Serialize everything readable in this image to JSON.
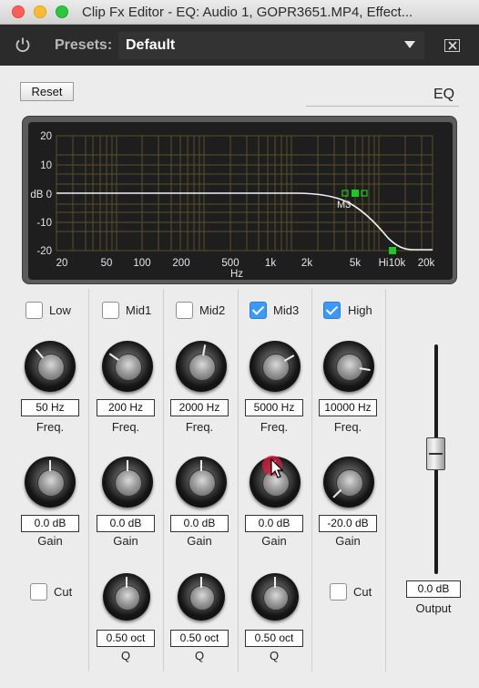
{
  "window": {
    "title": "Clip Fx Editor - EQ: Audio 1, GOPR3651.MP4, Effect..."
  },
  "toolbar": {
    "presets_label": "Presets:",
    "preset_value": "Default"
  },
  "reset_label": "Reset",
  "eq_label": "EQ",
  "graph": {
    "y_ticks": [
      "20",
      "10",
      "dB 0",
      "-10",
      "-20"
    ],
    "x_ticks": [
      "20",
      "50",
      "100",
      "200",
      "500",
      "1k",
      "2k",
      "5k",
      "Hi",
      "10k",
      "20k"
    ],
    "x_unit": "Hz",
    "marker_label": "M3"
  },
  "bands": [
    {
      "name": "Low",
      "enabled": false,
      "freq": "50 Hz",
      "gain": "0.0 dB",
      "cut_label": "Cut",
      "cut_enabled": false
    },
    {
      "name": "Mid1",
      "enabled": false,
      "freq": "200 Hz",
      "gain": "0.0 dB",
      "q": "0.50 oct"
    },
    {
      "name": "Mid2",
      "enabled": false,
      "freq": "2000 Hz",
      "gain": "0.0 dB",
      "q": "0.50 oct"
    },
    {
      "name": "Mid3",
      "enabled": true,
      "freq": "5000 Hz",
      "gain": "0.0 dB",
      "q": "0.50 oct"
    },
    {
      "name": "High",
      "enabled": true,
      "freq": "10000 Hz",
      "gain": "-20.0 dB",
      "cut_label": "Cut",
      "cut_enabled": false
    }
  ],
  "labels": {
    "freq": "Freq.",
    "gain": "Gain",
    "q": "Q",
    "output": "Output"
  },
  "output": {
    "value": "0.0 dB"
  }
}
